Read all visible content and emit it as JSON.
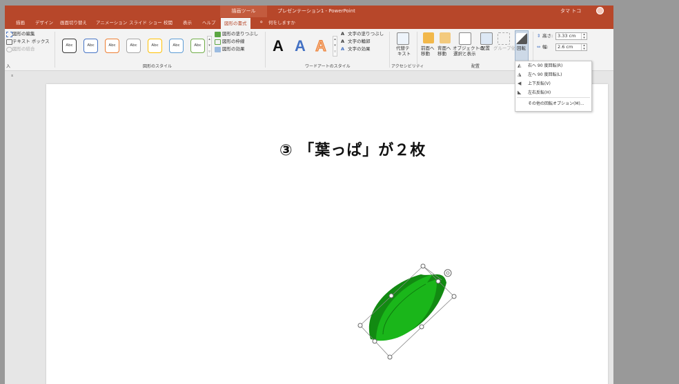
{
  "titlebar": {
    "context_tool": "描画ツール",
    "document_title": "プレゼンテーション1 - PowerPoint",
    "user_name": "タマ トコ"
  },
  "tabs": [
    {
      "label": "描画"
    },
    {
      "label": "デザイン"
    },
    {
      "label": "画面切り替え"
    },
    {
      "label": "アニメーション"
    },
    {
      "label": "スライド ショー"
    },
    {
      "label": "校閲"
    },
    {
      "label": "表示"
    },
    {
      "label": "ヘルプ"
    },
    {
      "label": "図形の書式",
      "active": true
    }
  ],
  "tell_me": "何をしますか",
  "ribbon": {
    "insert_shapes": {
      "edit_shape": "図形の編集",
      "text_box": "テキスト ボックス",
      "merge_shapes": "図形の結合",
      "group_label": "入"
    },
    "shape_styles": {
      "preview_text": "Abc",
      "colors": [
        "#333333",
        "#4472c4",
        "#ed7d31",
        "#a5a5a5",
        "#ffc000",
        "#5b9bd5",
        "#70ad47"
      ],
      "fill": "図形の塗りつぶし",
      "outline": "図形の枠線",
      "effects": "図形の効果",
      "group_label": "図形のスタイル"
    },
    "wordart": {
      "letter": "A",
      "text_fill": "文字の塗りつぶし",
      "text_outline": "文字の輪郭",
      "text_effects": "文字の効果",
      "group_label": "ワードアートのスタイル"
    },
    "accessibility": {
      "alt_text_line1": "代替テ",
      "alt_text_line2": "キスト",
      "group_label": "アクセシビリティ"
    },
    "arrange": {
      "bring_forward_1": "前面へ",
      "bring_forward_2": "移動",
      "send_backward_1": "背面へ",
      "send_backward_2": "移動",
      "selection_pane_1": "オブジェクトの",
      "selection_pane_2": "選択と表示",
      "align": "配置",
      "group": "グループ化",
      "rotate": "回転",
      "group_label": "配置"
    },
    "size": {
      "height_label": "高さ:",
      "height_value": "3.33 cm",
      "width_label": "幅:",
      "width_value": "2.6 cm"
    }
  },
  "rotate_menu": {
    "items": [
      {
        "icon": "rotate-right-icon",
        "label": "右へ 90 度回転(R)"
      },
      {
        "icon": "rotate-left-icon",
        "label": "左へ 90 度回転(L)"
      },
      {
        "icon": "flip-vertical-icon",
        "label": "上下反転(V)"
      },
      {
        "icon": "flip-horizontal-icon",
        "label": "左右反転(H)"
      },
      {
        "icon": "",
        "label": "その他の回転オプション(M)..."
      }
    ]
  },
  "slide": {
    "heading": "③ 「葉っぱ」が２枚",
    "leaf_color": "#1aa31a"
  }
}
